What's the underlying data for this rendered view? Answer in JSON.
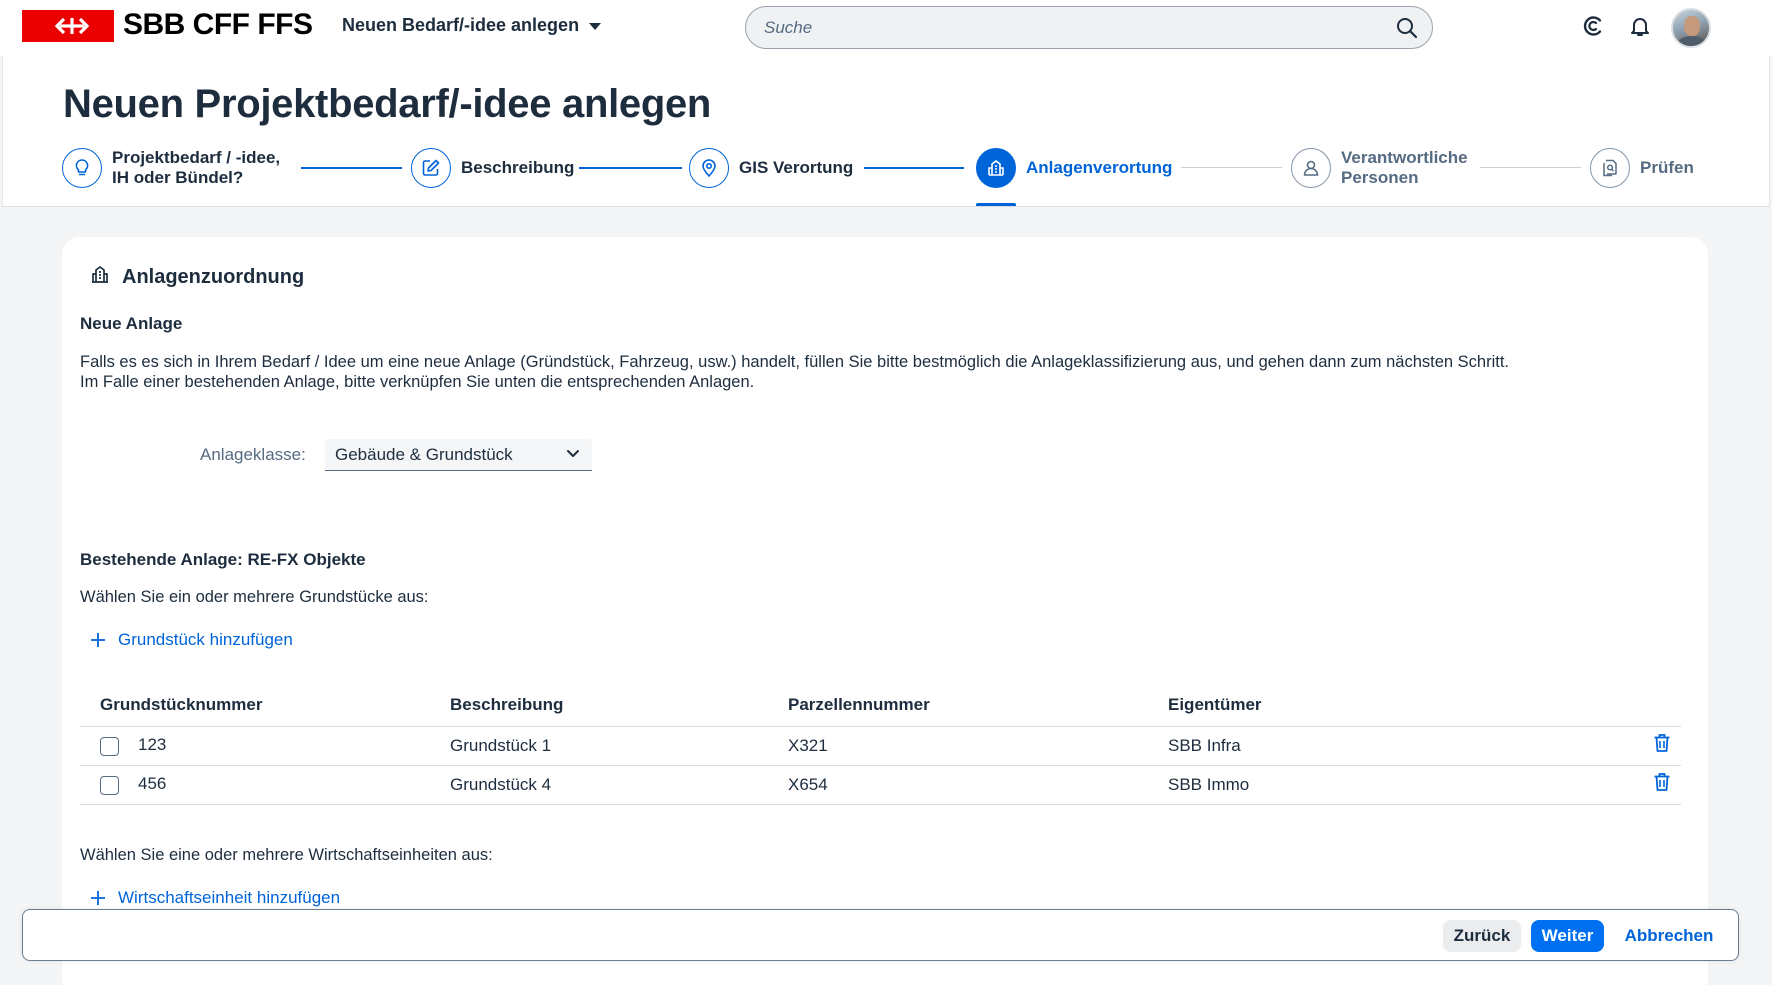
{
  "shell": {
    "brand": "SBB CFF FFS",
    "app_title": "Neuen Bedarf/-idee anlegen",
    "search_placeholder": "Suche",
    "icons": [
      "search-icon",
      "copilot-icon",
      "bell-icon",
      "avatar"
    ]
  },
  "header": {
    "title": "Neuen Projektbedarf/-idee anlegen",
    "steps": [
      {
        "label_line1": "Projektbedarf / -idee,",
        "label_line2": "IH oder Bündel?",
        "icon": "lightbulb-icon",
        "state": "done"
      },
      {
        "label_line1": "Beschreibung",
        "label_line2": "",
        "icon": "edit-icon",
        "state": "done"
      },
      {
        "label_line1": "GIS Verortung",
        "label_line2": "",
        "icon": "location-pin-icon",
        "state": "done"
      },
      {
        "label_line1": "Anlagenverortung",
        "label_line2": "",
        "icon": "building-icon",
        "state": "active"
      },
      {
        "label_line1": "Verantwortliche",
        "label_line2": "Personen",
        "icon": "person-icon",
        "state": "inactive"
      },
      {
        "label_line1": "Prüfen",
        "label_line2": "",
        "icon": "review-icon",
        "state": "inactive"
      }
    ]
  },
  "content": {
    "section_title": "Anlagenzuordnung",
    "new_asset": {
      "heading": "Neue Anlage",
      "text_line1": "Falls es es sich in Ihrem Bedarf / Idee um eine neue Anlage (Gründstück, Fahrzeug, usw.) handelt, füllen Sie bitte bestmöglich die Anlageklassifizierung aus, und gehen dann zum nächsten Schritt.",
      "text_line2": "Im Falle einer bestehenden Anlage, bitte verknüpfen Sie unten die entsprechenden Anlagen.",
      "class_label": "Anlageklasse:",
      "class_value": "Gebäude & Grundstück"
    },
    "existing": {
      "heading": "Bestehende Anlage: RE-FX Objekte",
      "plots_prompt": "Wählen Sie ein oder mehrere Grundstücke aus:",
      "add_plot": "Grundstück hinzufügen",
      "columns": [
        "Grundstücknummer",
        "Beschreibung",
        "Parzellennummer",
        "Eigentümer"
      ],
      "rows": [
        {
          "number": "123",
          "description": "Grundstück 1",
          "parcel": "X321",
          "owner": "SBB Infra",
          "checked": false
        },
        {
          "number": "456",
          "description": "Grundstück 4",
          "parcel": "X654",
          "owner": "SBB Immo",
          "checked": false
        }
      ],
      "units_prompt": "Wählen Sie eine oder mehrere Wirtschaftseinheiten aus:",
      "add_unit": "Wirtschaftseinheit hinzufügen"
    }
  },
  "footer": {
    "back": "Zurück",
    "next": "Weiter",
    "cancel": "Abbrechen"
  },
  "colors": {
    "accent": "#0064d9",
    "brand_red": "#eb0000",
    "text": "#1d2d3e",
    "muted": "#556b82",
    "background": "#f4f5f6"
  }
}
